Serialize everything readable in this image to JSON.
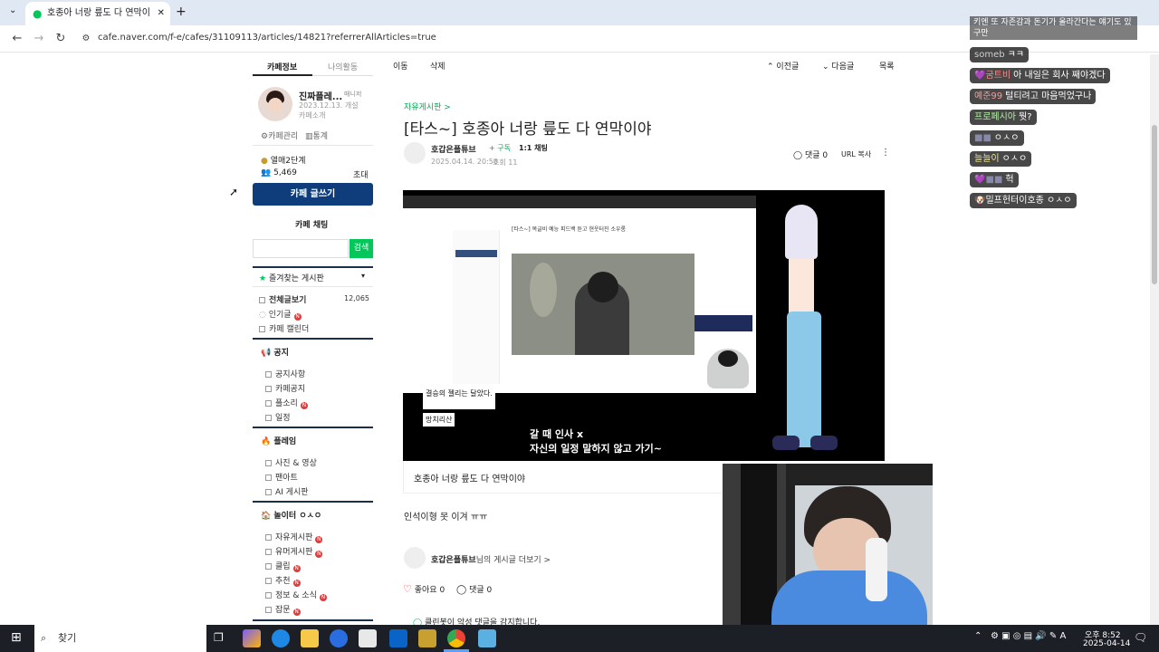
{
  "browser": {
    "tab_title": "호종아 너랑 릎도 다 연막이",
    "url": "cafe.naver.com/f-e/cafes/31109113/articles/14821?referrerAllArticles=true"
  },
  "sidebar": {
    "tab_cafe_info": "카페정보",
    "tab_my_activity": "나의활동",
    "cafe_name": "진짜플레...",
    "manager_label": "매니저",
    "founded": "2023.12.13. 개설",
    "intro": "카페소개",
    "manage": "카페관리",
    "stats": "통계",
    "rank": "열매2단계",
    "members": "5,469",
    "invite": "초대",
    "write_button": "카페 글쓰기",
    "chat_button": "카페 채팅",
    "search_button": "검색",
    "favorites": "즐겨찾는 게시판",
    "all_posts": "전체글보기",
    "all_posts_count": "12,065",
    "popular": "인기글",
    "calendar": "카페 캘린더",
    "sections": [
      {
        "title": "공지",
        "items": [
          "공지사항",
          "카페공지",
          "플소리",
          "일정"
        ]
      },
      {
        "title": "플레임",
        "items": [
          "사진 & 영상",
          "팬아트",
          "AI 게시판"
        ]
      },
      {
        "title": "놀이터 ㅇㅅㅇ",
        "items": [
          "자유게시판",
          "유머게시판",
          "클립",
          "추천",
          "정보 & 소식",
          "잡문"
        ]
      }
    ]
  },
  "article": {
    "action_move": "이동",
    "action_delete": "삭제",
    "prev": "이전글",
    "next": "다음글",
    "list": "목록",
    "board": "자유게시판 >",
    "title": "[타스~] 호종아 너랑 릎도 다 연막이야",
    "author": "호갑은플튜브",
    "subscribe": "구독",
    "chat": "1:1 채팅",
    "date": "2025.04.14. 20:50",
    "views": "조회 11",
    "comments_label": "댓글 0",
    "url_copy": "URL 복사",
    "caption": "호종아 너랑 릎도 다 연막이야",
    "body": "인석이형 못 이겨 ㅠㅠ",
    "more_posts_author": "호갑은플튜브",
    "more_posts_suffix": "님의 게시글 더보기 >",
    "like": "좋아요 0",
    "comment": "댓글 0",
    "cleanbot": "클린봇이 악성 댓글을 감지합니다."
  },
  "image_overlay": {
    "subtitle1": "갈 때 인사 x",
    "subtitle2": "자신의 일정 말하지 않고 가기~",
    "note1": "결승의 젤리는 달았다.",
    "note2": "망치리산",
    "inner_title": "[타스~] 목글비 예능 피드백 듣고 현웃터진 소우롱"
  },
  "chat_overlay": {
    "top_msg": "키엔 또 자존감과 돈기가 올라간다는 얘기도 있구만",
    "messages": [
      {
        "nick": "someb",
        "text": "ㅋㅋ"
      },
      {
        "nick": "굼트비",
        "text": "아 내일은 회사 째야겠다"
      },
      {
        "nick": "예준99",
        "text": "털티려고 마음먹었구나"
      },
      {
        "nick": "프로페시아",
        "text": "뭣?"
      },
      {
        "nick": "",
        "text": "ㅇㅅㅇ"
      },
      {
        "nick": "늘늘이",
        "text": "ㅇㅅㅇ"
      },
      {
        "nick": "",
        "text": "헉"
      },
      {
        "nick": "",
        "text": "밀프헌터이호종 ㅇㅅㅇ"
      }
    ]
  },
  "taskbar": {
    "search": "찾기",
    "time": "오후 8:52",
    "date": "2025-04-14"
  }
}
